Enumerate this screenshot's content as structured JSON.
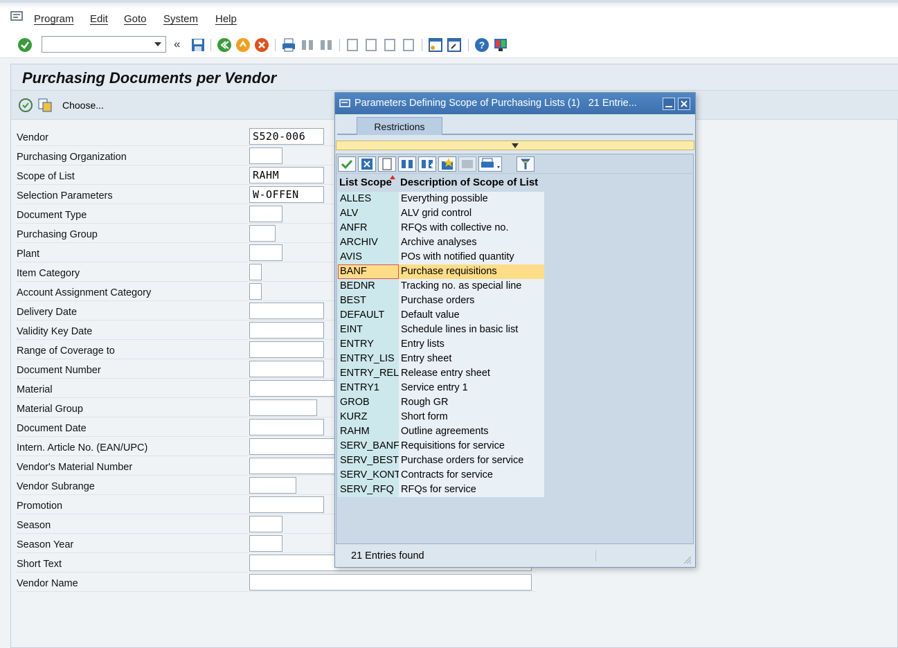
{
  "menu": {
    "items": [
      "Program",
      "Edit",
      "Goto",
      "System",
      "Help"
    ]
  },
  "toolbar": {
    "command_value": ""
  },
  "screen": {
    "title": "Purchasing Documents per Vendor",
    "choose_label": "Choose...",
    "fields": [
      {
        "label": "Vendor",
        "value": "S520-006"
      },
      {
        "label": "Purchasing Organization",
        "value": ""
      },
      {
        "label": "Scope of List",
        "value": "RAHM"
      },
      {
        "label": "Selection Parameters",
        "value": "W-OFFEN"
      },
      {
        "label": "Document Type",
        "value": ""
      },
      {
        "label": "Purchasing Group",
        "value": ""
      },
      {
        "label": "Plant",
        "value": ""
      },
      {
        "label": "Item Category",
        "value": ""
      },
      {
        "label": "Account Assignment Category",
        "value": ""
      },
      {
        "label": "Delivery Date",
        "value": ""
      },
      {
        "label": "Validity Key Date",
        "value": ""
      },
      {
        "label": "Range of Coverage to",
        "value": ""
      },
      {
        "label": "Document Number",
        "value": ""
      },
      {
        "label": "Material",
        "value": ""
      },
      {
        "label": "Material Group",
        "value": ""
      },
      {
        "label": "Document Date",
        "value": ""
      },
      {
        "label": "Intern. Article No. (EAN/UPC)",
        "value": ""
      },
      {
        "label": "Vendor's Material Number",
        "value": ""
      },
      {
        "label": "Vendor Subrange",
        "value": ""
      },
      {
        "label": "Promotion",
        "value": ""
      },
      {
        "label": "Season",
        "value": ""
      },
      {
        "label": "Season Year",
        "value": ""
      },
      {
        "label": "Short Text",
        "value": ""
      },
      {
        "label": "Vendor Name",
        "value": ""
      }
    ]
  },
  "dialog": {
    "title": "Parameters Defining Scope of Purchasing Lists (1)",
    "entries_title": "21 Entrie...",
    "tab_label": "Restrictions",
    "col_scope": "List Scope",
    "col_desc": "Description of Scope of List",
    "status": "21 Entries found",
    "rows": [
      {
        "scope": "ALLES",
        "desc": "Everything possible"
      },
      {
        "scope": "ALV",
        "desc": "ALV grid control"
      },
      {
        "scope": "ANFR",
        "desc": "RFQs with collective no."
      },
      {
        "scope": "ARCHIV",
        "desc": "Archive analyses"
      },
      {
        "scope": "AVIS",
        "desc": "POs with notified quantity"
      },
      {
        "scope": "BANF",
        "desc": "Purchase requisitions",
        "selected": true
      },
      {
        "scope": "BEDNR",
        "desc": "Tracking no. as special line"
      },
      {
        "scope": "BEST",
        "desc": "Purchase orders"
      },
      {
        "scope": "DEFAULT",
        "desc": "Default value"
      },
      {
        "scope": "EINT",
        "desc": "Schedule lines in basic list"
      },
      {
        "scope": "ENTRY",
        "desc": "Entry lists"
      },
      {
        "scope": "ENTRY_LIS",
        "desc": "Entry sheet"
      },
      {
        "scope": "ENTRY_REL",
        "desc": "Release entry sheet"
      },
      {
        "scope": "ENTRY1",
        "desc": "Service entry 1"
      },
      {
        "scope": "GROB",
        "desc": "Rough GR"
      },
      {
        "scope": "KURZ",
        "desc": "Short form"
      },
      {
        "scope": "RAHM",
        "desc": "Outline agreements"
      },
      {
        "scope": "SERV_BANF",
        "desc": "Requisitions for service"
      },
      {
        "scope": "SERV_BEST",
        "desc": "Purchase orders for service"
      },
      {
        "scope": "SERV_KONT",
        "desc": "Contracts for service"
      },
      {
        "scope": "SERV_RFQ",
        "desc": "RFQs for service"
      }
    ]
  },
  "colors": {
    "dialog_title": "#3d6fad",
    "selected_row": "#ffdd88",
    "scope_column": "#cde8ec"
  }
}
